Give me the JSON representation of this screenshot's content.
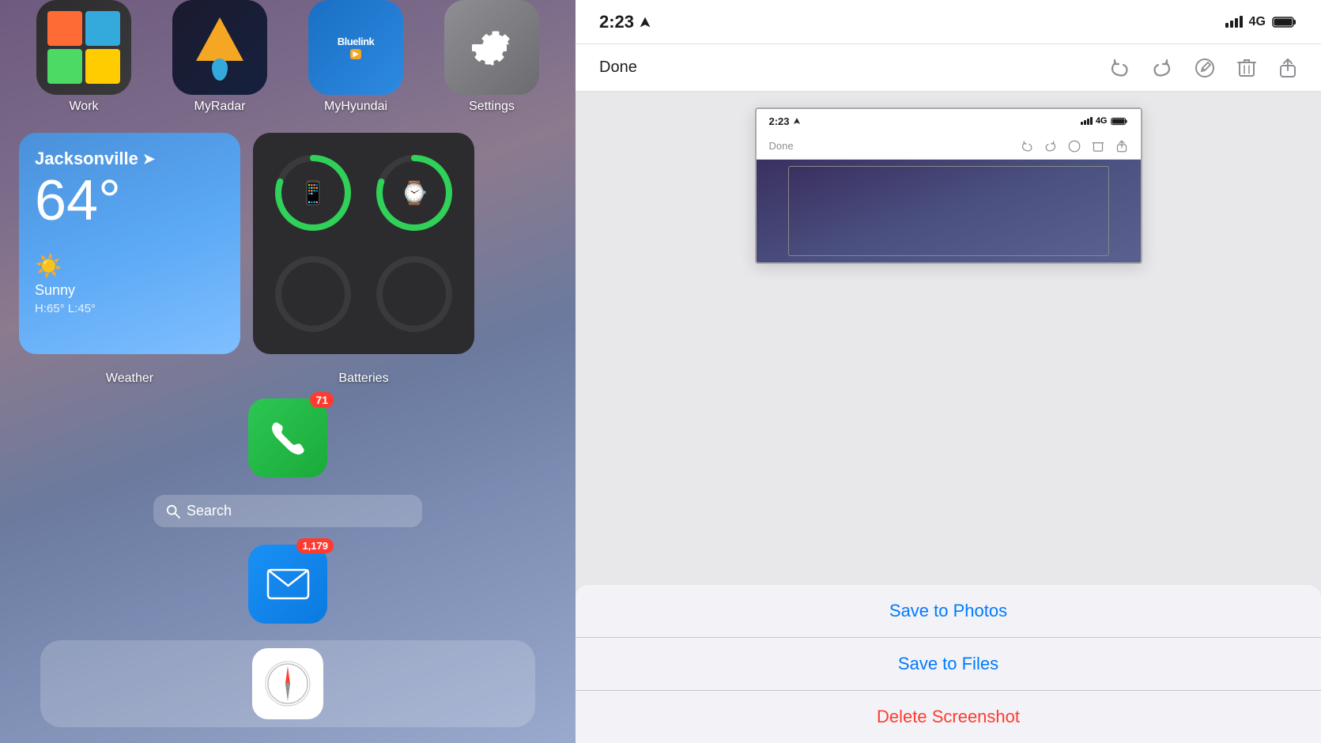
{
  "left_panel": {
    "apps_top": [
      {
        "name": "Work",
        "label": "Work"
      },
      {
        "name": "MyRadar",
        "label": "MyRadar"
      },
      {
        "name": "MyHyundai",
        "label": "MyHyundai"
      },
      {
        "name": "Settings",
        "label": "Settings"
      }
    ],
    "weather_widget": {
      "city": "Jacksonville",
      "temp": "64°",
      "condition": "Sunny",
      "range": "H:65°  L:45°"
    },
    "batteries_label": "Batteries",
    "phone": {
      "badge": "71",
      "label": "Phone"
    },
    "search": {
      "placeholder": "Search",
      "icon": "magnifying-glass"
    },
    "mail": {
      "badge": "1,179",
      "label": "Mail"
    },
    "weather_label": "Weather"
  },
  "right_panel": {
    "status_bar": {
      "time": "2:23",
      "nav_icon": "navigation-arrow",
      "signal": "4G",
      "battery": "full"
    },
    "toolbar": {
      "done_label": "Done",
      "undo_icon": "undo-arrow",
      "redo_icon": "redo-arrow",
      "pen_icon": "pen-circle",
      "trash_icon": "trash",
      "share_icon": "share"
    },
    "preview": {
      "status_time": "2:23",
      "done_label": "Done"
    },
    "action_sheet": {
      "save_photos_label": "Save to Photos",
      "save_files_label": "Save to Files",
      "delete_label": "Delete Screenshot"
    }
  }
}
